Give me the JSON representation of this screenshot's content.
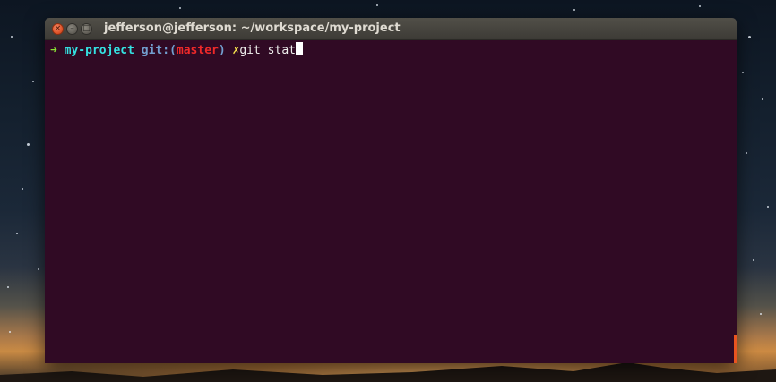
{
  "window": {
    "title": "jefferson@jefferson: ~/workspace/my-project"
  },
  "window_controls": {
    "close_glyph": "×",
    "minimize_glyph": "–",
    "maximize_glyph": "□"
  },
  "terminal": {
    "prompt": {
      "arrow": "➜",
      "directory": "my-project",
      "git_label": "git:",
      "open_paren": "(",
      "branch": "master",
      "close_paren": ")",
      "dirty_marker": "✗"
    },
    "command": "git stat"
  },
  "colors": {
    "terminal_bg": "#300a24",
    "arrow": "#8ae234",
    "directory": "#34e2e2",
    "git_label": "#729fcf",
    "branch": "#ef2929",
    "dirty_marker": "#fce94f",
    "accent": "#e95420"
  },
  "icons": {
    "close": "close-icon",
    "minimize": "minimize-icon",
    "maximize": "maximize-icon"
  }
}
